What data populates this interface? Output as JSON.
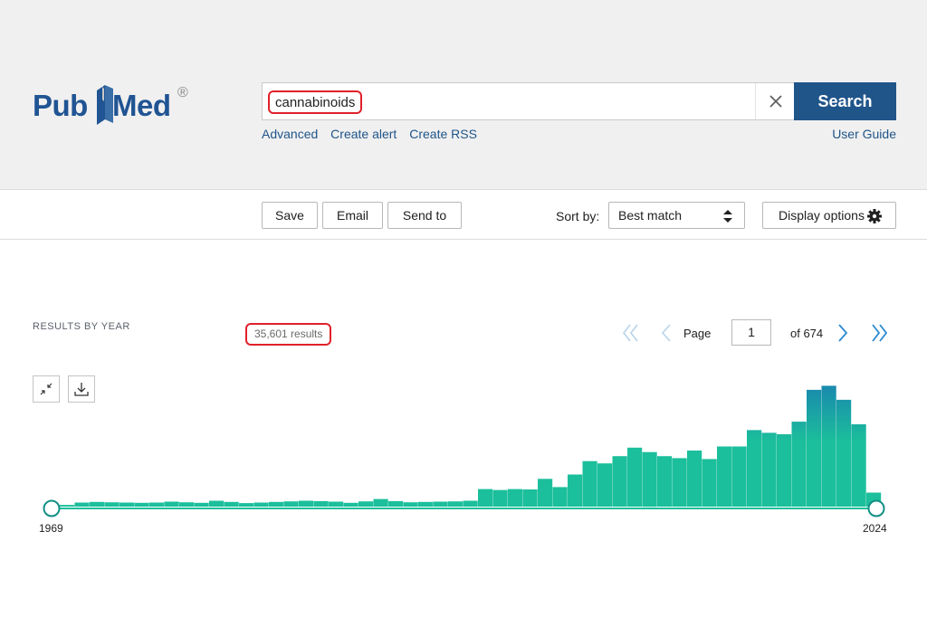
{
  "brand": {
    "name_a": "Pub",
    "name_b": "Med",
    "reg": "®"
  },
  "search": {
    "query": "cannabinoids",
    "button": "Search",
    "clear_icon": "close-icon"
  },
  "links": {
    "advanced": "Advanced",
    "create_alert": "Create alert",
    "create_rss": "Create RSS",
    "user_guide": "User Guide"
  },
  "toolbar": {
    "save": "Save",
    "email": "Email",
    "send_to": "Send to",
    "sort_label": "Sort by:",
    "sort_value": "Best match",
    "display": "Display options"
  },
  "results": {
    "by_year_label": "RESULTS BY YEAR",
    "count": "35,601 results"
  },
  "pager": {
    "page_label": "Page",
    "page": "1",
    "of": "of 674"
  },
  "timeline": {
    "start_year": "1969",
    "end_year": "2024"
  },
  "colors": {
    "brand": "#205493",
    "button": "#20558a",
    "bar_bottom": "#1bbf9b",
    "bar_top": "#1a73b5",
    "highlight": "#e0202a"
  },
  "chart_data": {
    "type": "bar",
    "title": "",
    "xlabel": "",
    "ylabel": "",
    "x": [
      1969,
      1970,
      1971,
      1972,
      1973,
      1974,
      1975,
      1976,
      1977,
      1978,
      1979,
      1980,
      1981,
      1982,
      1983,
      1984,
      1985,
      1986,
      1987,
      1988,
      1989,
      1990,
      1991,
      1992,
      1993,
      1994,
      1995,
      1996,
      1997,
      1998,
      1999,
      2000,
      2001,
      2002,
      2003,
      2004,
      2005,
      2006,
      2007,
      2008,
      2009,
      2010,
      2011,
      2012,
      2013,
      2014,
      2015,
      2016,
      2017,
      2018,
      2019,
      2020,
      2021,
      2022,
      2023,
      2024
    ],
    "values": [
      30,
      70,
      80,
      75,
      70,
      65,
      70,
      85,
      75,
      65,
      100,
      80,
      60,
      70,
      80,
      90,
      100,
      95,
      85,
      65,
      90,
      130,
      95,
      75,
      80,
      85,
      90,
      100,
      300,
      285,
      300,
      295,
      475,
      335,
      550,
      780,
      740,
      865,
      1010,
      935,
      865,
      830,
      960,
      815,
      1030,
      1030,
      1310,
      1265,
      1240,
      1455,
      2000,
      2070,
      1830,
      1410,
      240,
      0
    ],
    "ylim": [
      0,
      2200
    ],
    "grid": false,
    "legend": "none"
  }
}
